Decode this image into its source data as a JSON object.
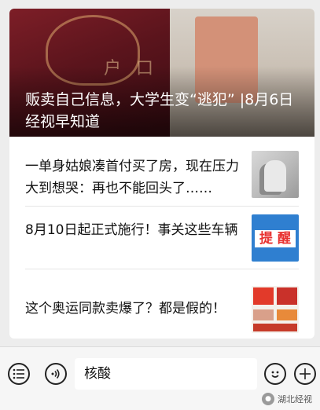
{
  "card": {
    "hero": {
      "title": "贩卖自己信息，大学生变“逃犯” |8月6日经视早知道",
      "passport_text": "户 口",
      "image": "passport-and-blurred-person"
    },
    "items": [
      {
        "title": "一单身姑娘凑首付买了房，现在压力大到想哭：再也不能回头了……",
        "thumb": "sad-woman-photo"
      },
      {
        "title": "8月10日起正式施行！事关这些车辆",
        "thumb_text": "提 醒",
        "thumb": "reminder-image"
      },
      {
        "title": "这个奥运同款卖爆了？都是假的！",
        "thumb": "olympic-products-image"
      }
    ]
  },
  "bottom_bar": {
    "input_value": "核酸",
    "menu_icon": "list-icon",
    "voice_icon": "voice-icon",
    "emoji_icon": "emoji-icon",
    "add_icon": "plus-icon",
    "watermark": "湖北经视"
  }
}
